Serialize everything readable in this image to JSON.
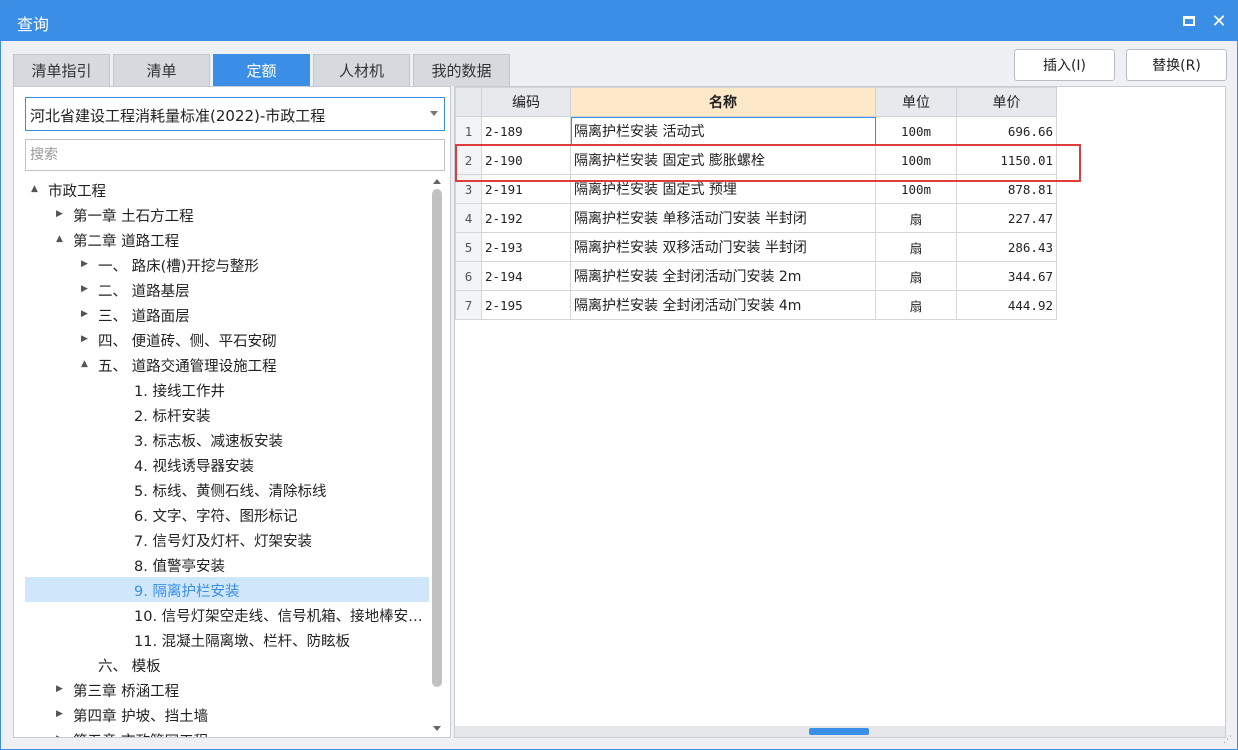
{
  "window": {
    "title": "查询"
  },
  "tabs": [
    {
      "label": "清单指引",
      "active": false
    },
    {
      "label": "清单",
      "active": false
    },
    {
      "label": "定额",
      "active": true
    },
    {
      "label": "人材机",
      "active": false
    },
    {
      "label": "我的数据",
      "active": false
    }
  ],
  "buttons": {
    "insert": "插入(I)",
    "replace": "替换(R)"
  },
  "library": {
    "selected": "河北省建设工程消耗量标准(2022)-市政工程"
  },
  "search": {
    "placeholder": "搜索"
  },
  "tree": [
    {
      "label": "市政工程",
      "level": 0,
      "arrow": "▲"
    },
    {
      "label": "第一章 土石方工程",
      "level": 1,
      "arrow": "▶"
    },
    {
      "label": "第二章 道路工程",
      "level": 1,
      "arrow": "▲"
    },
    {
      "label": "一、 路床(槽)开挖与整形",
      "level": 2,
      "arrow": "▶"
    },
    {
      "label": "二、 道路基层",
      "level": 2,
      "arrow": "▶"
    },
    {
      "label": "三、 道路面层",
      "level": 2,
      "arrow": "▶"
    },
    {
      "label": "四、 便道砖、侧、平石安砌",
      "level": 2,
      "arrow": "▶"
    },
    {
      "label": "五、 道路交通管理设施工程",
      "level": 2,
      "arrow": "▲"
    },
    {
      "label": "1. 接线工作井",
      "level": 3,
      "arrow": ""
    },
    {
      "label": "2. 标杆安装",
      "level": 3,
      "arrow": ""
    },
    {
      "label": "3. 标志板、减速板安装",
      "level": 3,
      "arrow": ""
    },
    {
      "label": "4. 视线诱导器安装",
      "level": 3,
      "arrow": ""
    },
    {
      "label": "5. 标线、黄侧石线、清除标线",
      "level": 3,
      "arrow": ""
    },
    {
      "label": "6. 文字、字符、图形标记",
      "level": 3,
      "arrow": ""
    },
    {
      "label": "7. 信号灯及灯杆、灯架安装",
      "level": 3,
      "arrow": ""
    },
    {
      "label": "8. 值警亭安装",
      "level": 3,
      "arrow": ""
    },
    {
      "label": "9. 隔离护栏安装",
      "level": 3,
      "arrow": "",
      "selected": true
    },
    {
      "label": "10. 信号灯架空走线、信号机箱、接地棒安…",
      "level": 3,
      "arrow": ""
    },
    {
      "label": "11. 混凝土隔离墩、栏杆、防眩板",
      "level": 3,
      "arrow": ""
    },
    {
      "label": "六、 模板",
      "level": 2,
      "arrow": ""
    },
    {
      "label": "第三章 桥涵工程",
      "level": 1,
      "arrow": "▶"
    },
    {
      "label": "第四章 护坡、挡土墙",
      "level": 1,
      "arrow": "▶"
    },
    {
      "label": "第五章 市政管网工程",
      "level": 1,
      "arrow": "▶"
    }
  ],
  "table": {
    "headers": {
      "code": "编码",
      "name": "名称",
      "unit": "单位",
      "price": "单价"
    },
    "rows": [
      {
        "no": "1",
        "code": "2-189",
        "name": "隔离护栏安装 活动式",
        "unit": "100m",
        "price": "696.66"
      },
      {
        "no": "2",
        "code": "2-190",
        "name": "隔离护栏安装 固定式 膨胀螺栓",
        "unit": "100m",
        "price": "1150.01"
      },
      {
        "no": "3",
        "code": "2-191",
        "name": "隔离护栏安装 固定式 预埋",
        "unit": "100m",
        "price": "878.81"
      },
      {
        "no": "4",
        "code": "2-192",
        "name": "隔离护栏安装 单移活动门安装 半封闭",
        "unit": "扇",
        "price": "227.47"
      },
      {
        "no": "5",
        "code": "2-193",
        "name": "隔离护栏安装 双移活动门安装 半封闭",
        "unit": "扇",
        "price": "286.43"
      },
      {
        "no": "6",
        "code": "2-194",
        "name": "隔离护栏安装 全封闭活动门安装 2m",
        "unit": "扇",
        "price": "344.67"
      },
      {
        "no": "7",
        "code": "2-195",
        "name": "隔离护栏安装 全封闭活动门安装 4m",
        "unit": "扇",
        "price": "444.92"
      }
    ]
  },
  "colors": {
    "accent": "#3a8ee6",
    "highlight_box": "#e03c3c",
    "header_highlight": "#fde8c8"
  }
}
